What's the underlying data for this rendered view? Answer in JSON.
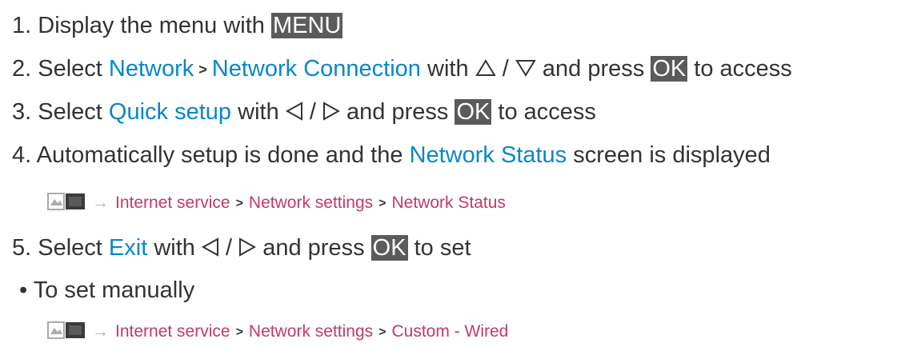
{
  "steps": [
    {
      "num": "1.",
      "pre": "Display the menu with",
      "key": "MENU"
    },
    {
      "num": "2.",
      "pre": "Select",
      "k1": "Network",
      "sep": ">",
      "k2": "Network Connection",
      "with": "with",
      "slash": "/",
      "mid": "and press",
      "key": "OK",
      "post": "to access"
    },
    {
      "num": "3.",
      "pre": "Select",
      "k1": "Quick setup",
      "with": "with",
      "slash": "/",
      "mid": "and press",
      "key": "OK",
      "post": "to access"
    },
    {
      "num": "4.",
      "pre": "Automatically setup is done and the",
      "k1": "Network Status",
      "post": "screen is displayed"
    },
    {
      "num": "5.",
      "pre": "Select",
      "k1": "Exit",
      "with": "with",
      "slash": "/",
      "mid": "and press",
      "key": "OK",
      "post": "to set"
    }
  ],
  "ref1": {
    "arrow": "→",
    "a": "Internet service",
    "sep": ">",
    "b": "Network settings",
    "c": "Network Status"
  },
  "bullet": {
    "mark": "•",
    "text": "To set manually"
  },
  "ref2": {
    "arrow": "→",
    "a": "Internet service",
    "sep": ">",
    "b": "Network settings",
    "c": "Custom - Wired"
  },
  "icons": {
    "up": "triangle-up",
    "down": "triangle-down",
    "left": "triangle-left",
    "right": "triangle-right",
    "book": "ebook-icon"
  },
  "colors": {
    "keyword": "#0a86c9",
    "key_bg": "#5b5b5b",
    "reference": "#c2396a",
    "text": "#333333"
  }
}
